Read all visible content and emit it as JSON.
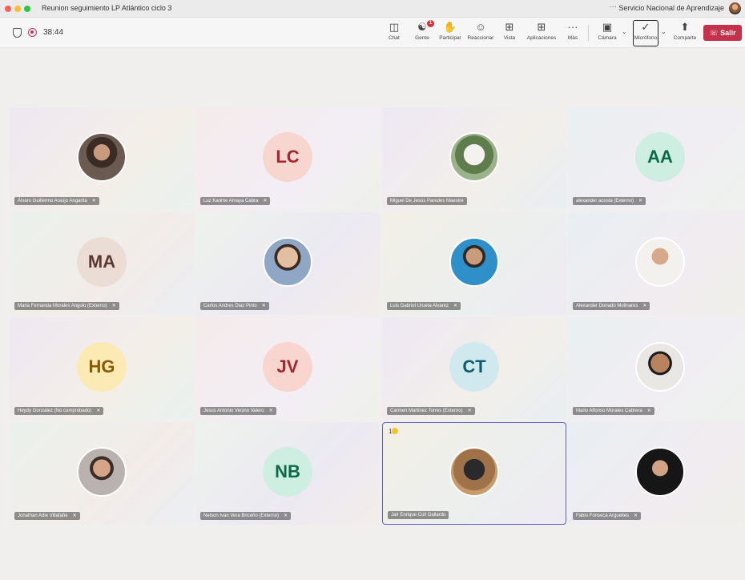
{
  "window": {
    "title": "Reunion seguimiento LP Atlántico ciclo 3",
    "organization": "Servicio Nacional de Aprendizaje",
    "more": "···"
  },
  "meeting": {
    "timer": "38:44"
  },
  "toolbar": {
    "chat": "Chat",
    "people": "Gente",
    "people_badge": "1",
    "raise": "Participar",
    "react": "Reaccionar",
    "view": "Vista",
    "apps": "Aplicaciones",
    "more": "Más",
    "camera": "Cámara",
    "mic": "Micrófono",
    "share": "Comparte",
    "leave": "Salir"
  },
  "participants": [
    {
      "name": "Álvaro Guillermo Araújo Angarita",
      "initials": "",
      "photo": "p1",
      "muted": true
    },
    {
      "name": "Luz Karime Amaya Cabra",
      "initials": "LC",
      "muted": true
    },
    {
      "name": "Miguel De Jesús Paredes Maestre",
      "initials": "",
      "photo": "p2",
      "muted": false
    },
    {
      "name": "alexander acosta (Externo)",
      "initials": "AA",
      "muted": true
    },
    {
      "name": "Maria Fernanda Morales Angulo (Externo)",
      "initials": "MA",
      "muted": true
    },
    {
      "name": "Carlos Andres Diaz Pinto",
      "initials": "",
      "photo": "p3",
      "muted": true
    },
    {
      "name": "Luis Gabriel Urueta Alvarez",
      "initials": "",
      "photo": "p4",
      "muted": true
    },
    {
      "name": "Alexander Donado Molinares",
      "initials": "",
      "photo": "p5",
      "muted": true
    },
    {
      "name": "Heydy González (No comprobado)",
      "initials": "HG",
      "muted": true
    },
    {
      "name": "Jesus Antonio Vecino Valero",
      "initials": "JV",
      "muted": true
    },
    {
      "name": "Carmen Martinez Torres (Externo)",
      "initials": "CT",
      "muted": true
    },
    {
      "name": "Mario Alfonso Morales Cabrera",
      "initials": "",
      "photo": "p6",
      "muted": true
    },
    {
      "name": "Jonathan Adie Villafañe",
      "initials": "",
      "photo": "p7",
      "muted": true
    },
    {
      "name": "Nelson Ivan Vera Briceño (Externo)",
      "initials": "NB",
      "muted": true
    },
    {
      "name": "Jair Enrique Coll Gallardo",
      "initials": "",
      "photo": "p8",
      "muted": false,
      "hand": "1"
    },
    {
      "name": "Fabio Fonseca Arguelles",
      "initials": "",
      "photo": "p9",
      "muted": true
    }
  ]
}
